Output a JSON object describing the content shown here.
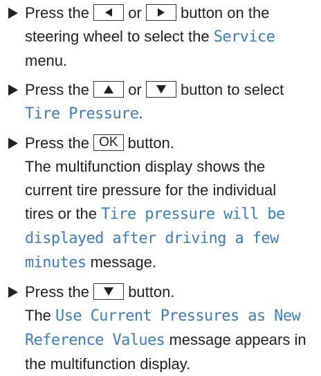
{
  "steps": [
    {
      "p1": "Press the",
      "key1_icon": "left-triangle-icon",
      "or": "or",
      "key2_icon": "right-triangle-icon",
      "p2": "button on the steering wheel to select the",
      "menu": "Service",
      "p3": "menu."
    },
    {
      "p1": "Press the",
      "key1_icon": "up-triangle-icon",
      "or": "or",
      "key2_icon": "down-triangle-icon",
      "p2": "button to select",
      "menu": "Tire Pressure",
      "p3": "."
    },
    {
      "p1": "Press the",
      "key_label": "OK",
      "p2": "button.",
      "result_1": "The multifunction display shows the current tire pressure for the individual tires or the",
      "message": "Tire pressure will be displayed after driving a few minutes",
      "result_2": "message."
    },
    {
      "p1": "Press the",
      "key1_icon": "down-triangle-icon",
      "p2": "button.",
      "result_1": "The",
      "message": "Use Current Pressures as New Reference Values",
      "result_2": "message appears in the multifunction display."
    }
  ],
  "bullet_icon": "right-arrow-bullet-icon",
  "colors": {
    "text": "#222222",
    "display_text": "#3a7fc1"
  }
}
